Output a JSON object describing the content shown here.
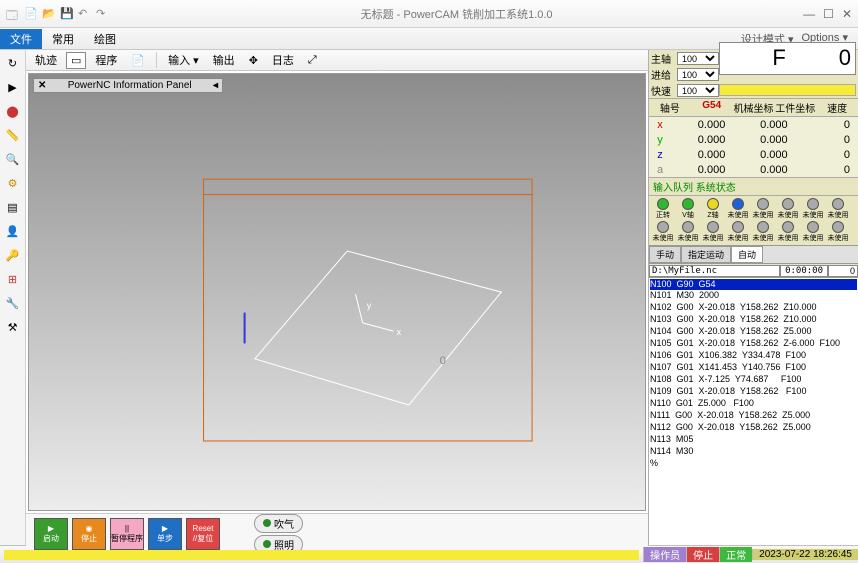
{
  "titlebar": {
    "title": "无标题 - PowerCAM 铣削加工系统1.0.0"
  },
  "menubar": {
    "items": [
      "文件",
      "常用",
      "绘图"
    ],
    "right": [
      "设计模式 ▾",
      "Options ▾"
    ]
  },
  "top_toolbar": {
    "b1": "轨迹",
    "b2": "程序",
    "b3": "输入 ▾",
    "b4": "输出",
    "b5": "日志"
  },
  "info_panel": {
    "title": "PowerNC Information Panel"
  },
  "axes_label": {
    "x": "x",
    "y": "y",
    "zero": "0"
  },
  "controls": {
    "c1": "启动",
    "c2": "停止",
    "c3": "||",
    "c4": "▶",
    "c5": "Reset"
  },
  "aux": {
    "a1": "吹气",
    "a2": "照明"
  },
  "speed": {
    "spindle_label": "主轴",
    "feed_label": "进给",
    "rapid_label": "快速",
    "spindle_val": "100",
    "feed_val": "100",
    "rapid_val": "100",
    "f_label": "F",
    "f_value": "0"
  },
  "coord": {
    "headers": [
      "轴号",
      "G54",
      "机械坐标",
      "工件坐标",
      "速度"
    ],
    "rows": [
      {
        "axis": "x",
        "m": "0.000",
        "w": "0.000",
        "s": "0"
      },
      {
        "axis": "y",
        "m": "0.000",
        "w": "0.000",
        "s": "0"
      },
      {
        "axis": "z",
        "m": "0.000",
        "w": "0.000",
        "s": "0"
      },
      {
        "axis": "a",
        "m": "0.000",
        "w": "0.000",
        "s": "0"
      }
    ]
  },
  "io_header": "输入队列 系统状态",
  "leds": [
    {
      "c": "led-g",
      "t": "正转"
    },
    {
      "c": "led-g",
      "t": "V轴"
    },
    {
      "c": "led-y",
      "t": "Z轴"
    },
    {
      "c": "led-b",
      "t": "未使用"
    },
    {
      "c": "led-gray",
      "t": "未使用"
    },
    {
      "c": "led-gray",
      "t": "未使用"
    },
    {
      "c": "led-gray",
      "t": "未使用"
    },
    {
      "c": "led-gray",
      "t": "未使用"
    },
    {
      "c": "led-gray",
      "t": "未使用"
    },
    {
      "c": "led-gray",
      "t": "未使用"
    },
    {
      "c": "led-gray",
      "t": "未使用"
    },
    {
      "c": "led-gray",
      "t": "未使用"
    },
    {
      "c": "led-gray",
      "t": "未使用"
    },
    {
      "c": "led-gray",
      "t": "未使用"
    },
    {
      "c": "led-gray",
      "t": "未使用"
    },
    {
      "c": "led-gray",
      "t": "未使用"
    }
  ],
  "tabs": {
    "t1": "手动",
    "t2": "指定运动",
    "t3": "自动"
  },
  "file": {
    "path": "D:\\MyFile.nc",
    "time": "0:00:00",
    "line": "0"
  },
  "gcode": {
    "hl": "N100  G90  G54",
    "rest": "N101  M30  2000\nN102  G00  X-20.018  Y158.262  Z10.000\nN103  G00  X-20.018  Y158.262  Z10.000\nN104  G00  X-20.018  Y158.262  Z5.000\nN105  G01  X-20.018  Y158.262  Z-6.000  F100\nN106  G01  X106.382  Y334.478  F100\nN107  G01  X141.453  Y140.756  F100\nN108  G01  X-7.125  Y74.687     F100\nN109  G01  X-20.018  Y158.262   F100\nN110  G01  Z5.000   F100\nN111  G00  X-20.018  Y158.262  Z5.000\nN112  G00  X-20.018  Y158.262  Z5.000\nN113  M05\nN114  M30\n%"
  },
  "status": {
    "op": "操作员",
    "stop": "停止",
    "ok": "正常",
    "time": "2023-07-22 18:26:45"
  }
}
